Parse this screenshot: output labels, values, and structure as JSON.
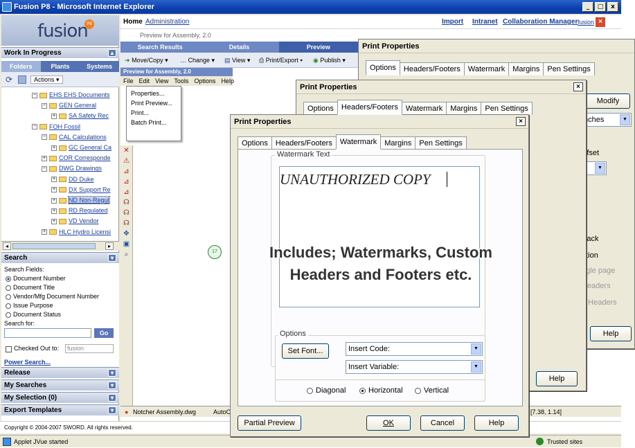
{
  "window": {
    "title": "Fusion P8 - Microsoft Internet Explorer",
    "caption_buttons": [
      "_",
      "□",
      "x"
    ]
  },
  "left": {
    "logo": "fusion",
    "logo_badge": "P8",
    "wip_header": "Work In Progress",
    "tabs": [
      "Folders",
      "Plants",
      "Systems"
    ],
    "actions_label": "Actions",
    "tree": [
      {
        "label": "EHS EHS Documents",
        "indent": 0,
        "pm": "⊟"
      },
      {
        "label": "GEN General",
        "indent": 1,
        "pm": "⊟"
      },
      {
        "label": "SA Safety Rec",
        "indent": 2,
        "pm": "⊞"
      },
      {
        "label": "FOH Fossil",
        "indent": 0,
        "pm": "⊟"
      },
      {
        "label": "CAL Calculations",
        "indent": 1,
        "pm": "⊟"
      },
      {
        "label": "GC General Ca",
        "indent": 2,
        "pm": "⊞"
      },
      {
        "label": "COR Corresponde",
        "indent": 1,
        "pm": "⊞"
      },
      {
        "label": "DWG Drawings",
        "indent": 1,
        "pm": "⊟"
      },
      {
        "label": "DD Duke",
        "indent": 2,
        "pm": "⊞"
      },
      {
        "label": "DX Support Re",
        "indent": 2,
        "pm": "⊞"
      },
      {
        "label": "ND Non-Regul",
        "indent": 2,
        "pm": "⊞"
      },
      {
        "label": "RD Regulated",
        "indent": 2,
        "pm": "⊞"
      },
      {
        "label": "VD Vendor",
        "indent": 2,
        "pm": "⊞"
      },
      {
        "label": "HLC Hydro Licensi",
        "indent": 1,
        "pm": "⊞"
      }
    ],
    "search_header": "Search",
    "search_fields_label": "Search Fields:",
    "search_fields": [
      "Document Number",
      "Document Title",
      "Vendor/Mfg Document Number",
      "Issue Purpose",
      "Document Status"
    ],
    "search_for_label": "Search for:",
    "go_label": "Go",
    "checked_out_label": "Checked Out to:",
    "checked_out_value": "fusion",
    "power_search": "Power Search...",
    "panels": [
      "Release",
      "My Searches",
      "My Selection (0)",
      "Export Templates"
    ]
  },
  "right": {
    "home": "Home",
    "admin": "Administration",
    "top_links": [
      "Import",
      "Intranet",
      "Collaboration Manager",
      "fusion"
    ],
    "assembly": "Preview for Assembly, 2.0",
    "view_tabs": [
      "Search Results",
      "Details",
      "Preview"
    ],
    "actions": [
      "Move/Copy",
      "Change",
      "View",
      "Print/Export",
      "Publish"
    ],
    "viewer_title": "Preview for Assembly, 2.0",
    "viewer_menu": [
      "File",
      "Edit",
      "View",
      "Tools",
      "Options",
      "Help"
    ],
    "context_menu": [
      "Properties...",
      "Print Preview...",
      "Print...",
      "Batch Print..."
    ],
    "status_file": "Notcher Assembly.dwg",
    "status_app": "AutoC",
    "coords": "[7.38, 1.14]"
  },
  "copyright": "Copyright © 2004-2007 SWORD. All rights reserved.",
  "ie_status": "Applet JVue started",
  "zone": "Trusted sites",
  "dialog_back": {
    "title": "Print Properties",
    "tabs": [
      "Options",
      "Headers/Footers",
      "Watermark",
      "Margins",
      "Pen Settings"
    ],
    "modify": "Modify",
    "inches": "Inches",
    "offset": "Offset",
    "fragments": [
      "Back",
      "ation",
      "ngle page",
      "Headers",
      "n Headers"
    ],
    "help": "Help"
  },
  "dialog_mid": {
    "title": "Print Properties",
    "tabs": [
      "Options",
      "Headers/Footers",
      "Watermark",
      "Margins",
      "Pen Settings"
    ],
    "help": "Help"
  },
  "dialog_front": {
    "title": "Print Properties",
    "tabs": [
      "Options",
      "Headers/Footers",
      "Watermark",
      "Margins",
      "Pen Settings"
    ],
    "watermark_group": "Watermark Text",
    "watermark_text": "UNAUTHORIZED COPY",
    "options_group": "Options",
    "set_font": "Set Font...",
    "insert_code": "Insert Code:",
    "insert_variable": "Insert Variable:",
    "orientations": [
      "Diagonal",
      "Horizontal",
      "Vertical"
    ],
    "orientation_selected": "Horizontal",
    "partial_preview": "Partial Preview",
    "ok": "OK",
    "cancel": "Cancel",
    "help": "Help"
  },
  "overlay": {
    "line1": "Includes; Watermarks, Custom",
    "line2": "Headers and Footers etc."
  }
}
